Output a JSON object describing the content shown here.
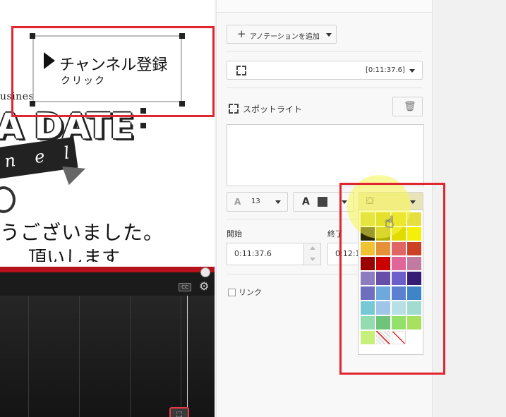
{
  "video": {
    "promo_business": "usiness",
    "promo_dashes": "------",
    "promo_big": "A DATE",
    "promo_ribbon": "n e l",
    "promo_jp1": "うございました。",
    "promo_jp2": "頂いします",
    "cc_label": "CC",
    "settings_icon": "gear-icon",
    "timeline_marker_icon": "spotlight-icon"
  },
  "annotation": {
    "title": "チャンネル登録",
    "subtitle": "クリック"
  },
  "panel": {
    "add_annotation_label": "アノテーションを追加",
    "time_range": "[0:11:37.6]",
    "spotlight_label": "スポットライト",
    "font_size": "13",
    "start_label": "開始",
    "end_label": "終了",
    "start_value": "0:11:37.6",
    "end_value": "0:12:1",
    "link_label": "リンク"
  },
  "palette": {
    "selected_bg_color": "#f4f00a",
    "colors": [
      "#cfcf2a",
      "#c7c700",
      "#d7d400",
      "#e5e040",
      "#2a2a00",
      "#b1b100",
      "#e0dc00",
      "#f4f00a",
      "#f1c232",
      "#e69138",
      "#e06666",
      "#cc4125",
      "#990000",
      "#cc0000",
      "#e06699",
      "#c27ba0",
      "#8e7cc3",
      "#674ea7",
      "#6d5fc9",
      "#351c75",
      "#6f6fc0",
      "#6fa8dc",
      "#5b7fd1",
      "#3d85c6",
      "#76c8d4",
      "#9fc5e8",
      "#b6e0e6",
      "#a2dcd0",
      "#93dbb0",
      "#6fc47a",
      "#93e06a",
      "#a8e060",
      "#c6f07a",
      "none",
      "none-white"
    ]
  }
}
